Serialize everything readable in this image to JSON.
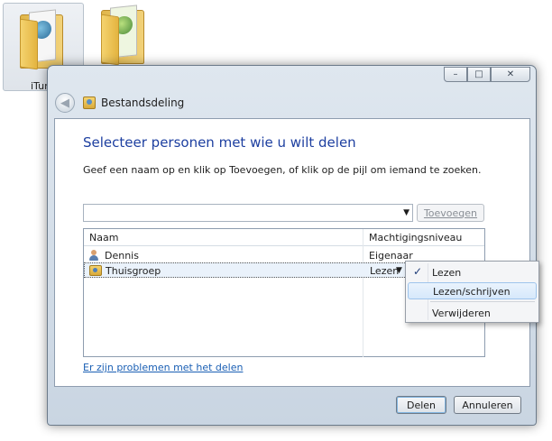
{
  "desktop": {
    "icons": [
      {
        "label": "iTun"
      },
      {
        "label": ""
      }
    ]
  },
  "window": {
    "caption_buttons": {
      "minimize": "–",
      "maximize": "□",
      "close": "✕"
    },
    "nav": {
      "back": "◀",
      "title": "Bestandsdeling"
    },
    "heading": "Selecteer personen met wie u wilt delen",
    "instruction": "Geef een naam op en klik op Toevoegen, of klik op de pijl om iemand te zoeken.",
    "name_input": {
      "value": "",
      "arrow": "▼"
    },
    "add_button": "Toevoegen",
    "table": {
      "columns": [
        "Naam",
        "Machtigingsniveau"
      ],
      "rows": [
        {
          "name": "Dennis",
          "level": "Eigenaar",
          "icon": "user-icon"
        },
        {
          "name": "Thuisgroep",
          "level": "Lezen",
          "icon": "homegroup-icon",
          "dropdown_arrow": "▼"
        }
      ]
    },
    "help_link": "Er zijn problemen met het delen",
    "buttons": {
      "share": "Delen",
      "cancel": "Annuleren"
    }
  },
  "permission_menu": {
    "items": [
      {
        "label": "Lezen",
        "check": "✓"
      },
      {
        "label": "Lezen/schrijven",
        "check": ""
      },
      {
        "label": "Verwijderen",
        "check": ""
      }
    ]
  }
}
